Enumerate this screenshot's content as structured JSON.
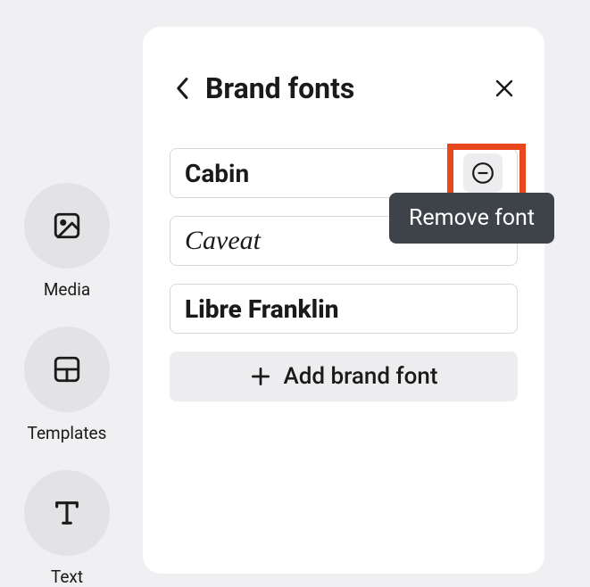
{
  "sidebar": {
    "items": [
      {
        "label": "Media"
      },
      {
        "label": "Templates"
      },
      {
        "label": "Text"
      }
    ]
  },
  "panel": {
    "title": "Brand fonts",
    "fonts": [
      {
        "name": "Cabin"
      },
      {
        "name": "Caveat"
      },
      {
        "name": "Libre Franklin"
      }
    ],
    "addButtonLabel": "Add brand font"
  },
  "tooltip": {
    "removeFont": "Remove font"
  }
}
